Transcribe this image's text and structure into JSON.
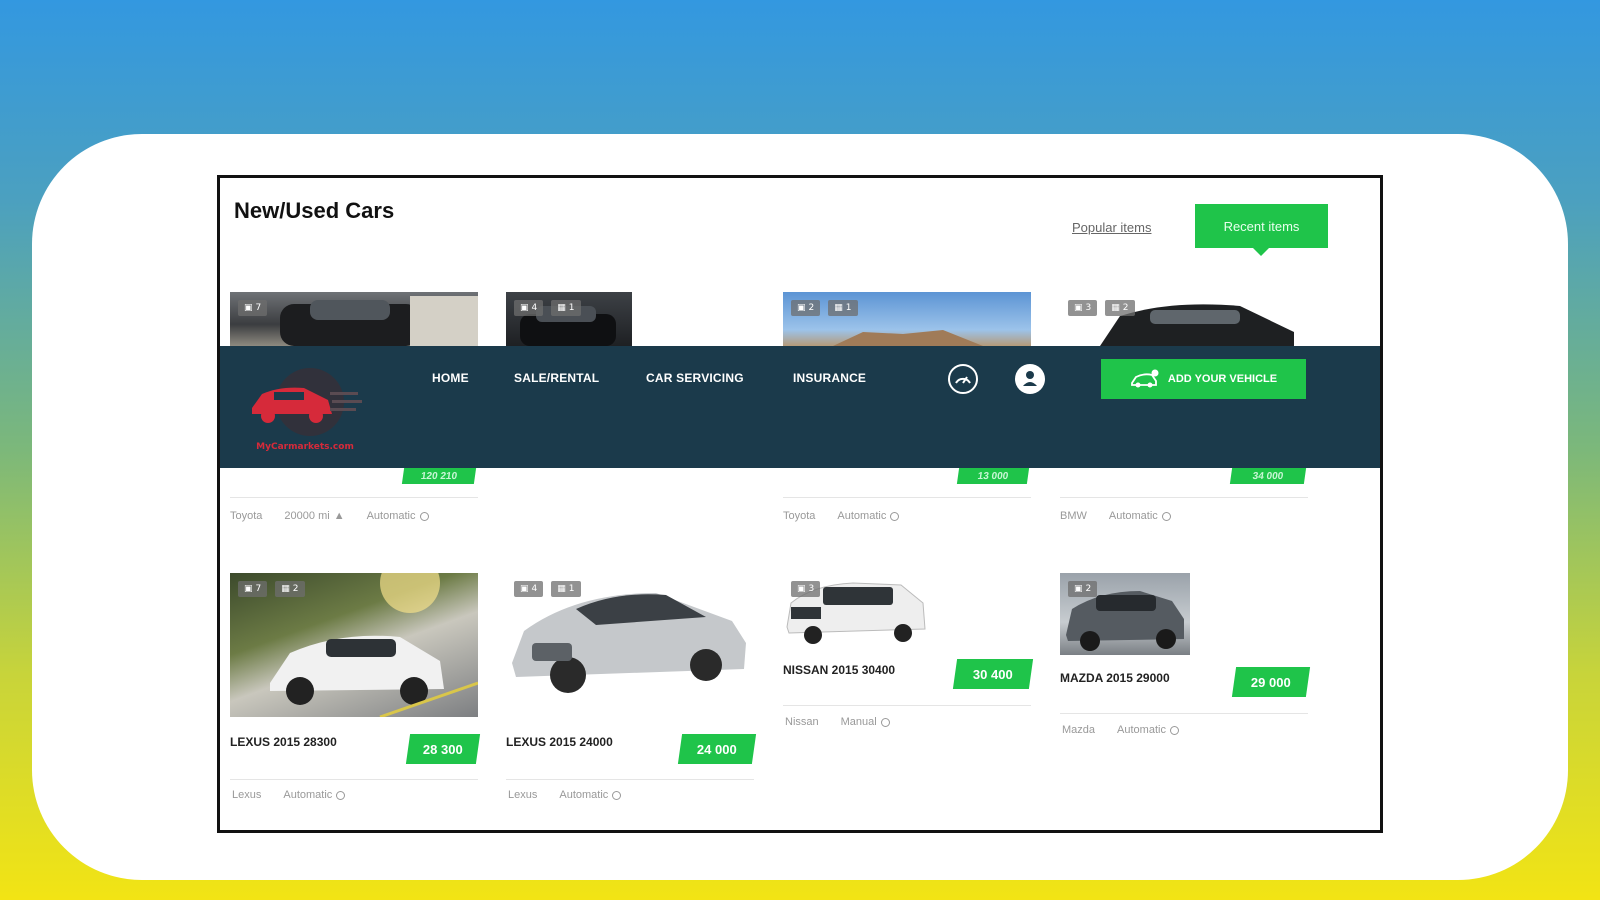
{
  "header": {
    "title": "New/Used Cars",
    "popular_label": "Popular items",
    "recent_label": "Recent items"
  },
  "nav": {
    "logo_text": "MyCarmarkets.com",
    "items": [
      "HOME",
      "SALE/RENTAL",
      "CAR SERVICING",
      "INSURANCE"
    ],
    "add_vehicle_label": "ADD YOUR VEHICLE"
  },
  "top_row": [
    {
      "photos": "7",
      "videos": "",
      "price": "120 210",
      "meta": [
        "Toyota",
        "20000 mi",
        "Automatic"
      ]
    },
    {
      "photos": "4",
      "videos": "1",
      "price": "",
      "meta": []
    },
    {
      "photos": "2",
      "videos": "1",
      "price": "13 000",
      "meta": [
        "Toyota",
        "Automatic"
      ]
    },
    {
      "photos": "3",
      "videos": "2",
      "price": "34 000",
      "meta": [
        "BMW",
        "Automatic"
      ]
    }
  ],
  "bottom_row": [
    {
      "photos": "7",
      "videos": "2",
      "name": "LEXUS 2015 28300",
      "price": "28 300",
      "meta": [
        "Lexus",
        "Automatic"
      ]
    },
    {
      "photos": "4",
      "videos": "1",
      "name": "LEXUS 2015 24000",
      "price": "24 000",
      "meta": [
        "Lexus",
        "Automatic"
      ]
    },
    {
      "photos": "3",
      "videos": "",
      "name": "NISSAN 2015 30400",
      "price": "30 400",
      "meta": [
        "Nissan",
        "Manual"
      ]
    },
    {
      "photos": "2",
      "videos": "",
      "name": "MAZDA 2015 29000",
      "price": "29 000",
      "meta": [
        "Mazda",
        "Automatic"
      ]
    }
  ]
}
